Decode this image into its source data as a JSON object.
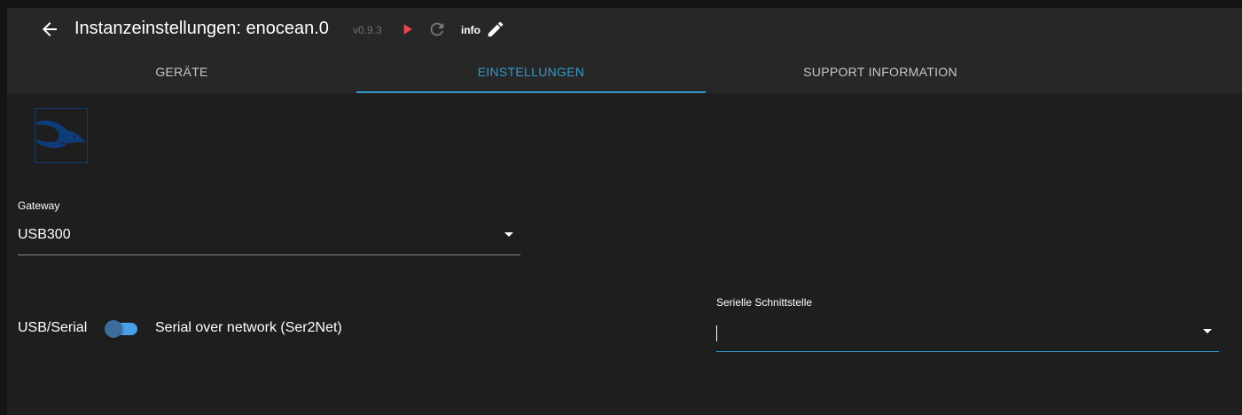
{
  "window": {
    "title": "Instanzeinstellungen: enocean.0",
    "version": "v0.9.3",
    "loglevel": "info"
  },
  "icons": {
    "back": "arrow-left-icon",
    "play": "play-icon",
    "reload": "reload-icon",
    "edit": "pencil-icon",
    "logo": "dolphin-logo-icon"
  },
  "colors": {
    "accent": "#3399cc",
    "play": "#e8474b",
    "background": "#1e1e1e",
    "header": "#272727",
    "switch_track": "#4aa0e6"
  },
  "tabs": [
    {
      "label": "GERÄTE",
      "active": false
    },
    {
      "label": "EINSTELLUNGEN",
      "active": true
    },
    {
      "label": "SUPPORT INFORMATION",
      "active": false
    }
  ],
  "form": {
    "gateway": {
      "label": "Gateway",
      "value": "USB300"
    },
    "connection": {
      "left_label": "USB/Serial",
      "right_label": "Serial over network (Ser2Net)",
      "checked": false
    },
    "serial_port": {
      "label": "Serielle Schnittstelle",
      "value": ""
    }
  }
}
